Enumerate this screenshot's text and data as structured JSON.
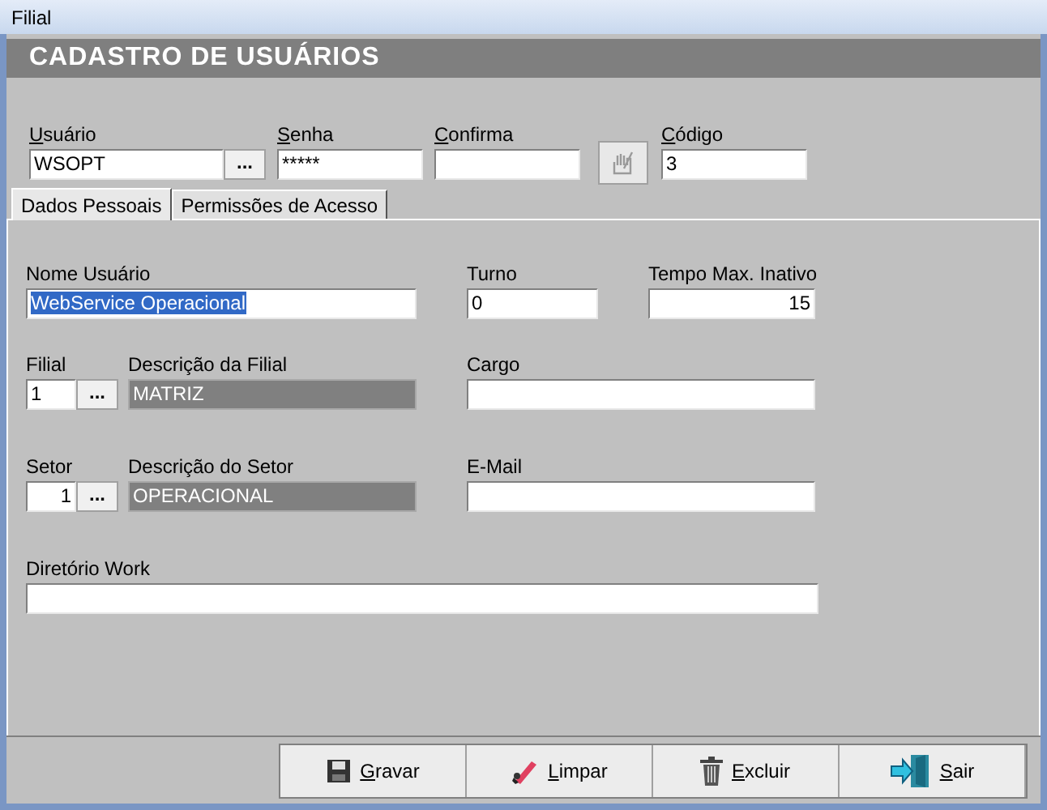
{
  "window": {
    "title": "Filial"
  },
  "header": {
    "title": "CADASTRO DE USUÁRIOS"
  },
  "top_fields": [
    {
      "kind": "field",
      "label": "Usuário",
      "mnemonic": true,
      "value": "WSOPT",
      "lookup_label": "..."
    },
    {
      "kind": "field",
      "label": "Senha",
      "mnemonic": true,
      "value": "*****"
    },
    {
      "kind": "field",
      "label": "Confirma",
      "mnemonic": true
    },
    {
      "kind": "icon_button",
      "disabled": true
    },
    {
      "kind": "field",
      "label": "Código",
      "mnemonic": true,
      "value": "3"
    }
  ],
  "tabs": [
    {
      "label": "Dados Pessoais",
      "selected": true
    },
    {
      "label": "Permissões de Acesso",
      "selected": false
    }
  ],
  "form": {
    "nome": {
      "label": "Nome Usuário",
      "value": "WebService Operacional",
      "text_selected": true
    },
    "turno": {
      "label": "Turno",
      "value": "0"
    },
    "tempo": {
      "label": "Tempo Max. Inativo",
      "value": "15"
    },
    "filial": {
      "label": "Filial",
      "value": "1",
      "lookup_label": "...",
      "desc_label": "Descrição da Filial",
      "desc_value": "MATRIZ"
    },
    "cargo": {
      "label": "Cargo"
    },
    "setor": {
      "label": "Setor",
      "value": "1",
      "lookup_label": "...",
      "desc_label": "Descrição do Setor",
      "desc_value": "OPERACIONAL"
    },
    "email": {
      "label": "E-Mail"
    },
    "diretorio": {
      "label": "Diretório Work"
    }
  },
  "buttons": [
    {
      "kind": "save",
      "label": "Gravar",
      "mnemonic": true
    },
    {
      "kind": "clear",
      "label": "Limpar",
      "mnemonic": true
    },
    {
      "kind": "delete",
      "label": "Excluir",
      "mnemonic": true
    },
    {
      "kind": "exit",
      "label": "Sair",
      "mnemonic": true
    }
  ]
}
